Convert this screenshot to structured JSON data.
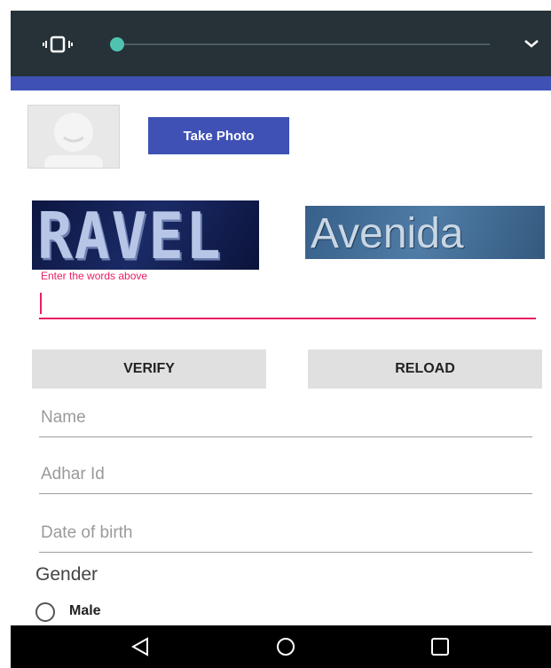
{
  "status_bar": {
    "vibrate_icon": "vibrate-icon",
    "slider_level": 0.0,
    "expand_icon": "chevron-down-icon"
  },
  "profile": {
    "avatar_icon": "avatar-placeholder",
    "take_photo_label": "Take Photo"
  },
  "captcha": {
    "word1": "RAVEL",
    "word2": "Avenida",
    "label": "Enter the words above",
    "value": ""
  },
  "buttons": {
    "verify_label": "VERIFY",
    "reload_label": "RELOAD"
  },
  "form": {
    "name_placeholder": "Name",
    "adhar_placeholder": "Adhar Id",
    "dob_placeholder": "Date of birth",
    "gender_label": "Gender",
    "gender_options": [
      "Male"
    ]
  },
  "navbar": {
    "back_icon": "back-triangle-icon",
    "home_icon": "home-circle-icon",
    "recent_icon": "recent-square-icon"
  },
  "colors": {
    "primary": "#3f51b5",
    "accent": "#e91e63",
    "slider_thumb": "#4fc3b0",
    "status_bg": "#263238"
  }
}
